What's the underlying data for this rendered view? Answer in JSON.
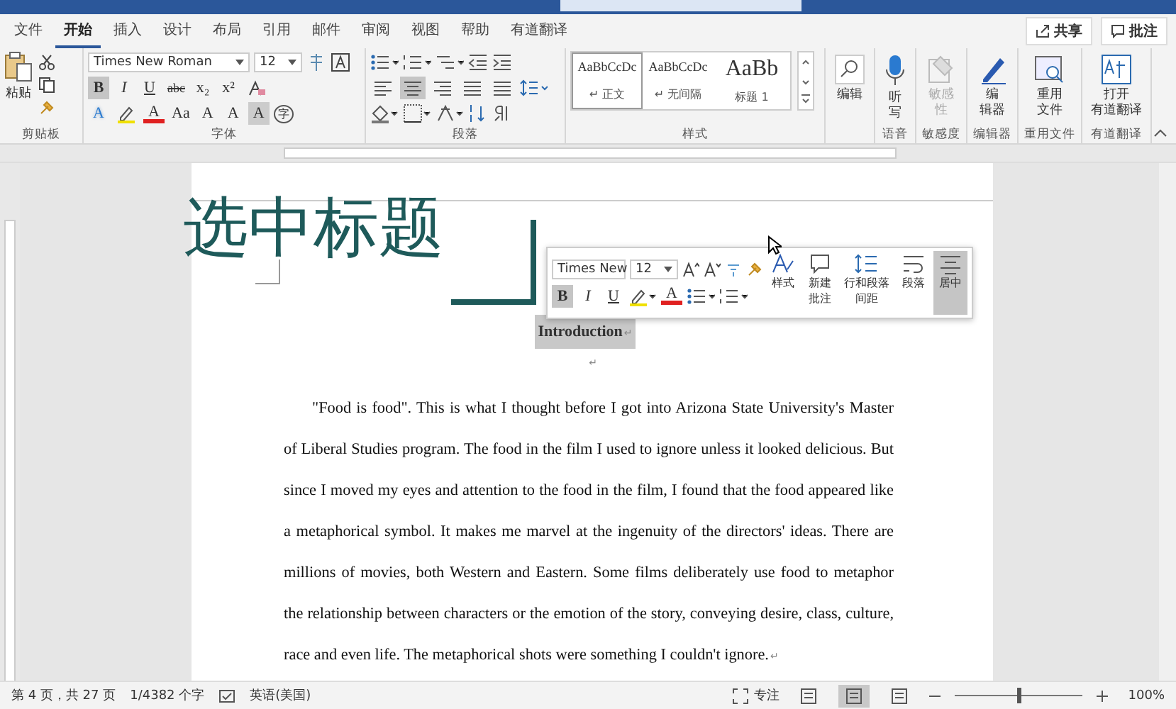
{
  "tabs": [
    {
      "label": "文件",
      "selected": false
    },
    {
      "label": "开始",
      "selected": true
    },
    {
      "label": "插入",
      "selected": false
    },
    {
      "label": "设计",
      "selected": false
    },
    {
      "label": "布局",
      "selected": false
    },
    {
      "label": "引用",
      "selected": false
    },
    {
      "label": "邮件",
      "selected": false
    },
    {
      "label": "审阅",
      "selected": false
    },
    {
      "label": "视图",
      "selected": false
    },
    {
      "label": "帮助",
      "selected": false
    },
    {
      "label": "有道翻译",
      "selected": false
    }
  ],
  "share": "共享",
  "comments": "批注",
  "clipboard": {
    "paste": "粘贴",
    "group": "剪贴板"
  },
  "font": {
    "group": "字体",
    "name": "Times New Roman",
    "size": "12",
    "row2": [
      {
        "kind": "glyph",
        "glyph": "B",
        "selected": true
      },
      {
        "kind": "glyph",
        "glyph": "I",
        "selected": false
      },
      {
        "kind": "glyph",
        "glyph": "U",
        "selected": false
      },
      {
        "kind": "glyph",
        "glyph": "abc",
        "selected": false
      },
      {
        "kind": "glyph",
        "glyph": "x₂",
        "selected": false
      },
      {
        "kind": "glyph",
        "glyph": "x²",
        "selected": false
      },
      {
        "kind": "eraser",
        "selected": false
      }
    ],
    "row3": [
      {
        "kind": "glow",
        "glyph": "A",
        "selected": false
      },
      {
        "kind": "highlight",
        "selected": false
      },
      {
        "kind": "color",
        "glyph": "A",
        "selected": false
      },
      {
        "kind": "glyph",
        "glyph": "Aa",
        "selected": false
      },
      {
        "kind": "glyph",
        "glyph": "A",
        "selected": false
      },
      {
        "kind": "glyph",
        "glyph": "A",
        "selected": false
      },
      {
        "kind": "shade",
        "glyph": "A",
        "selected": false
      },
      {
        "kind": "circle",
        "glyph": "字",
        "selected": false
      }
    ]
  },
  "paragraph": {
    "group": "段落",
    "align": [
      {
        "selected": false
      },
      {
        "selected": true
      },
      {
        "selected": false
      },
      {
        "selected": false
      },
      {
        "selected": false
      }
    ]
  },
  "styles": {
    "group": "样式",
    "items": [
      {
        "sample": "AaBbCcDc",
        "label": "↵ 正文",
        "selected": true
      },
      {
        "sample": "AaBbCcDc",
        "label": "↵ 无间隔",
        "selected": false
      },
      {
        "sample": "AaBb",
        "label": "标题 1",
        "selected": false
      }
    ]
  },
  "big_groups": [
    {
      "kind": "editing",
      "label": [
        "编辑"
      ],
      "disabled": false
    },
    {
      "kind": "dictate",
      "label": [
        "听",
        "写"
      ],
      "group": "语音",
      "disabled": false
    },
    {
      "kind": "sensitivity",
      "label": [
        "敏感",
        "性"
      ],
      "group": "敏感度",
      "disabled": true
    },
    {
      "kind": "editor",
      "label": [
        "编",
        "辑器"
      ],
      "group": "编辑器",
      "disabled": false
    },
    {
      "kind": "reuse",
      "label": [
        "重用",
        "文件"
      ],
      "group": "重用文件",
      "disabled": false
    },
    {
      "kind": "translate",
      "label": [
        "打开",
        "有道翻译"
      ],
      "group": "有道翻译",
      "disabled": false
    }
  ],
  "document": {
    "overlay_title": "选中标题",
    "heading": "Introduction",
    "heading_mark": "↵",
    "empty_mark": "↵",
    "paragraph": "\"Food is food\". This is what I thought before I got into Arizona State University's Master of Liberal Studies program. The food in the film I used to ignore unless it looked delicious. But since I moved my eyes and attention to the food in the film, I found that the food appeared like a metaphorical symbol. It makes me marvel at the ingenuity of the directors' ideas. There are millions of movies, both Western and Eastern. Some films deliberately use food to metaphor the relationship between characters or the emotion of the story, conveying desire, class, culture, race and even life.  The metaphorical shots were something I couldn't ignore.",
    "paragraph_mark": "↵"
  },
  "mini_toolbar": {
    "font": "Times New",
    "size": "12",
    "row2": [
      {
        "glyph": "B",
        "selected": true
      },
      {
        "glyph": "I",
        "selected": false
      },
      {
        "glyph": "U",
        "selected": false
      }
    ],
    "color_glyph": "A",
    "buttons": [
      {
        "kind": "styles",
        "label": [
          "样式"
        ],
        "selected": false
      },
      {
        "kind": "comment",
        "label": [
          "新建",
          "批注"
        ],
        "selected": false
      },
      {
        "kind": "spacing",
        "label": [
          "行和段落",
          "间距"
        ],
        "selected": false
      },
      {
        "kind": "paragraph",
        "label": [
          "段落"
        ],
        "selected": false
      },
      {
        "kind": "center",
        "label": [
          "居中"
        ],
        "selected": true
      }
    ]
  },
  "status_bar": {
    "page": "第 4 页，共 27 页",
    "words": "1/4382 个字",
    "language": "英语(美国)",
    "focus": "专注",
    "views": [
      {
        "selected": false
      },
      {
        "selected": true
      },
      {
        "selected": false
      }
    ],
    "zoom": {
      "level": 0.5,
      "reading": "100%"
    }
  }
}
